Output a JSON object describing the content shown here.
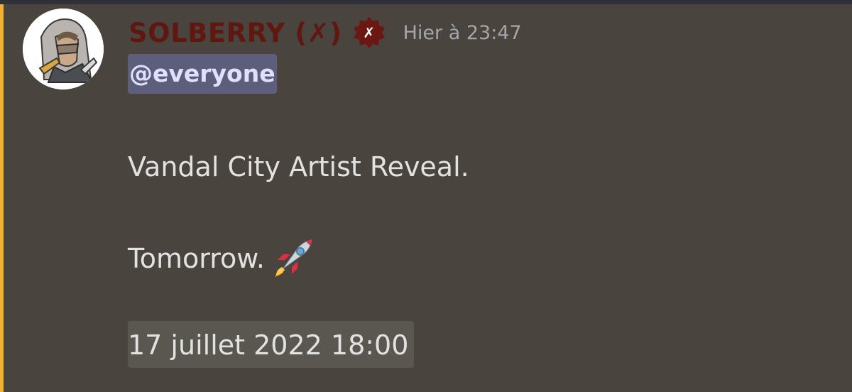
{
  "message": {
    "author": {
      "username": "SOLBERRY (✗)",
      "role_badge_glyph": "✗",
      "avatar_icon": "user-avatar-icon",
      "name_color": "#5f1710",
      "badge_color": "#6b1812"
    },
    "timestamp": "Hier à 23:47",
    "mention": "@everyone",
    "lines": [
      "Vandal City Artist Reveal.",
      "Tomorrow."
    ],
    "emoji": "rocket-icon",
    "event_time": "17 juillet 2022 18:00",
    "mention_highlight_color": "#f0b132"
  }
}
